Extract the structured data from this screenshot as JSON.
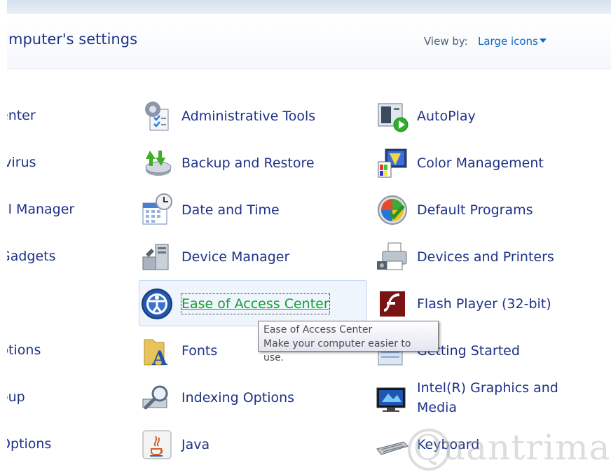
{
  "header": {
    "title": "mputer's settings",
    "view_by_label": "View by:",
    "view_by_value": "Large icons"
  },
  "items": {
    "left": [
      "enter",
      "ivirus",
      "al Manager",
      "Gadgets",
      "ptions",
      "oup",
      "Options"
    ],
    "middle": [
      "Administrative Tools",
      "Backup and Restore",
      "Date and Time",
      "Device Manager",
      "Ease of Access Center",
      "Fonts",
      "Indexing Options",
      "Java"
    ],
    "right": [
      "AutoPlay",
      "Color Management",
      "Default Programs",
      "Devices and Printers",
      "Flash Player (32-bit)",
      "Getting Started",
      "Intel(R) Graphics and Media",
      "Keyboard"
    ]
  },
  "tooltip": {
    "title": "Ease of Access Center",
    "description": "Make your computer easier to use."
  },
  "watermark": "Quantrimang"
}
